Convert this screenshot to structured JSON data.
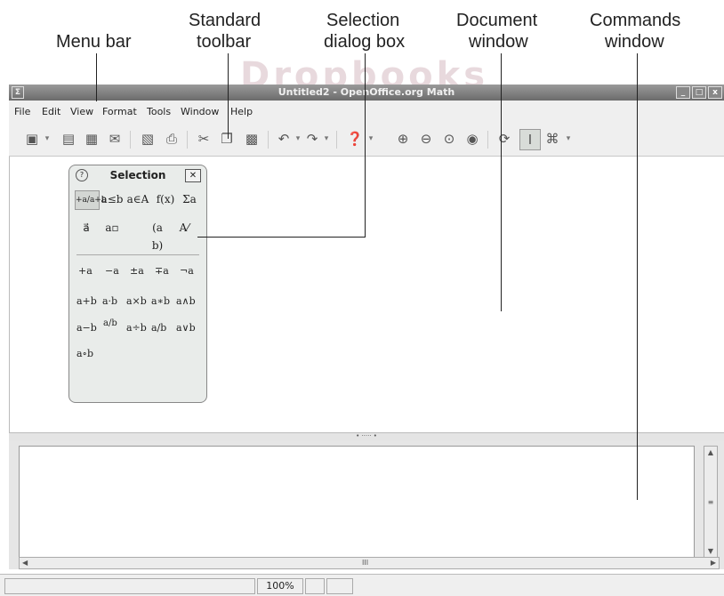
{
  "annotations": {
    "menu_bar": "Menu bar",
    "standard_toolbar_1": "Standard",
    "standard_toolbar_2": "toolbar",
    "selection_dialog_1": "Selection",
    "selection_dialog_2": "dialog box",
    "document_window_1": "Document",
    "document_window_2": "window",
    "commands_window_1": "Commands",
    "commands_window_2": "window"
  },
  "watermark": "Dropbooks",
  "window": {
    "title": "Untitled2 - OpenOffice.org Math",
    "app_icon": "Σ",
    "minimize": "_",
    "maximize": "□",
    "close": "x"
  },
  "menu": {
    "file": "File",
    "edit": "Edit",
    "view": "View",
    "format": "Format",
    "tools": "Tools",
    "window": "Window",
    "help": "Help"
  },
  "toolbar": {
    "icons": [
      "new-icon",
      "open-icon",
      "save-icon",
      "email-icon",
      "pdf-icon",
      "print-icon",
      "cut-icon",
      "copy-icon",
      "paste-icon",
      "undo-icon",
      "redo-icon",
      "help-icon",
      "zoom-in-icon",
      "zoom-out-icon",
      "zoom-100-icon",
      "show-all-icon",
      "update-icon",
      "formula-cursor-icon",
      "symbols-icon"
    ]
  },
  "selection": {
    "title": "Selection",
    "help_glyph": "?",
    "close_glyph": "✕",
    "categories": [
      "+a/a+b",
      "a≤b",
      "a∈A",
      "f(x)",
      "Σa"
    ],
    "categories_row2": [
      "a⃗",
      "a▫",
      "(a b)",
      "A⁄"
    ],
    "symbols": [
      [
        "+a",
        "−a",
        "±a",
        "∓a",
        "¬a"
      ],
      [
        "a+b",
        "a·b",
        "a×b",
        "a∗b",
        "a∧b"
      ],
      [
        "a−b",
        "a/b",
        "a÷b",
        "a/b",
        "a∨b"
      ],
      [
        "a∘b"
      ]
    ]
  },
  "commands_window": {
    "text": "",
    "hscroll_mark": "III"
  },
  "status": {
    "zoom": "100%"
  },
  "colors": {
    "watermark": "#e8d9dd",
    "titlebar": "#7d7d7d",
    "book_teal": "#d7f1f2"
  }
}
